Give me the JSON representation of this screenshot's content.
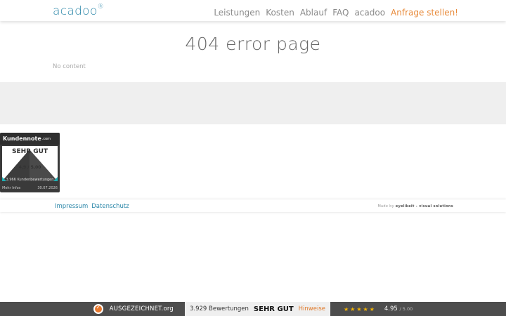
{
  "header": {
    "logo": "acadoo",
    "logo_mark": "®",
    "nav": [
      "Leistungen",
      "Kosten",
      "Ablauf",
      "FAQ",
      "acadoo"
    ],
    "cta": "Anfrage stellen!"
  },
  "main": {
    "title": "404 error page",
    "body": "No content"
  },
  "badge": {
    "brand": "Kundennote",
    "brand_suffix": ".com",
    "verdict": "SEHR GUT",
    "score": "4,9 / 5,00",
    "count": "3.966 Kundenbewertungen",
    "more": "Mehr Infos",
    "date": "30.07.2026"
  },
  "footer": {
    "links": [
      "Impressum",
      "Datenschutz"
    ],
    "made_by_prefix": "Made by",
    "made_by_name": "eyelikeit - visual solutions"
  },
  "rating_bar": {
    "brand": "AUSGEZEICHNET.org",
    "reviews": "3.929 Bewertungen",
    "verdict": "SEHR GUT",
    "hint": "Hinweise",
    "stars": "★★★★★",
    "score": "4.95",
    "max": "/ 5.00"
  },
  "colors": {
    "accent_blue": "#2a86a8",
    "accent_orange": "#e88a3a",
    "star": "#f5b400"
  }
}
